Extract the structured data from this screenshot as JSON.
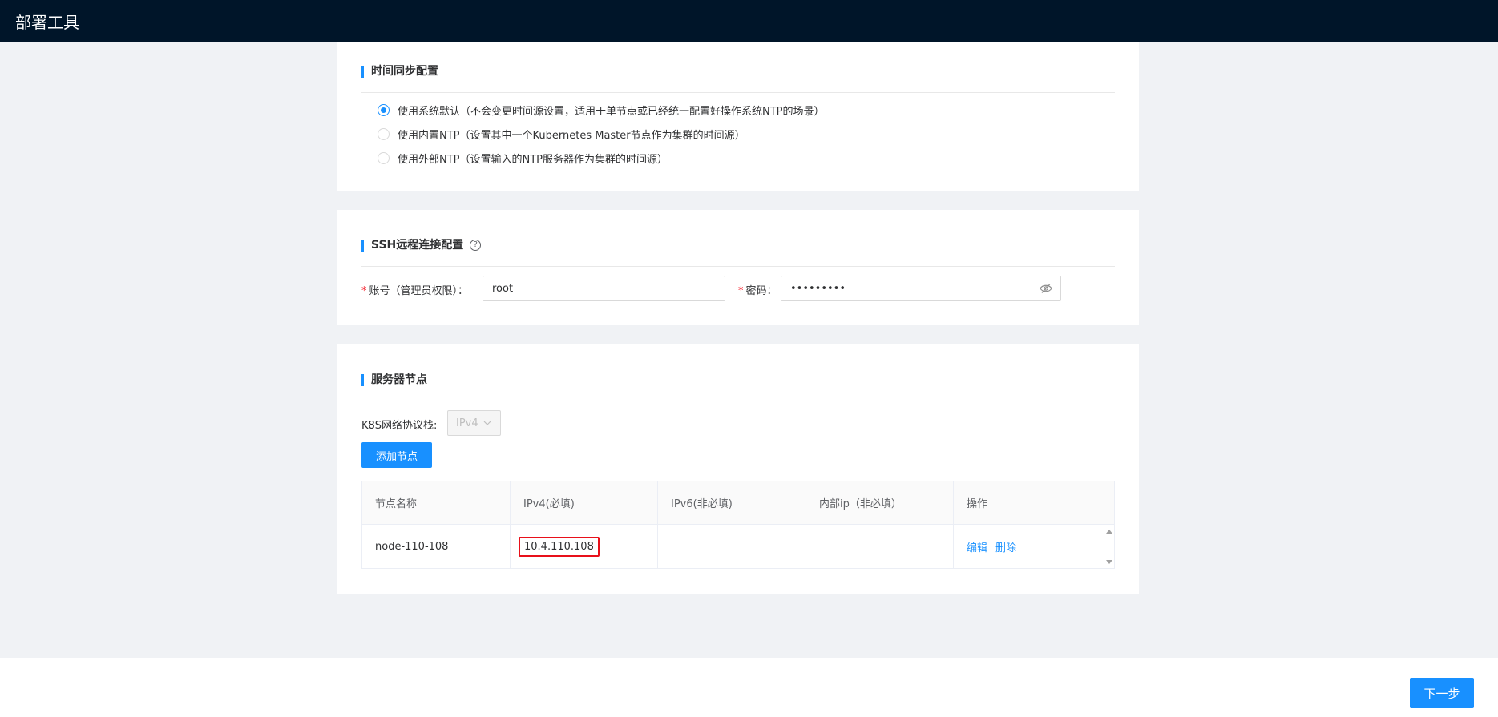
{
  "app": {
    "title": "部署工具"
  },
  "time_sync": {
    "title": "时间同步配置",
    "options": [
      {
        "label": "使用系统默认（不会变更时间源设置，适用于单节点或已经统一配置好操作系统NTP的场景）",
        "checked": true
      },
      {
        "label": "使用内置NTP（设置其中一个Kubernetes Master节点作为集群的时间源）",
        "checked": false
      },
      {
        "label": "使用外部NTP（设置输入的NTP服务器作为集群的时间源）",
        "checked": false
      }
    ]
  },
  "ssh": {
    "title": "SSH远程连接配置",
    "help_icon": "?",
    "account_required": "*",
    "account_label": "账号（管理员权限）：",
    "account_value": "root",
    "password_required": "*",
    "password_label": "密码：",
    "password_value": "•••••••••",
    "eye_icon": "eye-off-icon"
  },
  "nodes": {
    "title": "服务器节点",
    "protocol_label": "K8S网络协议栈:",
    "protocol_value": "IPv4",
    "add_button": "添加节点",
    "columns": [
      "节点名称",
      "IPv4(必填)",
      "IPv6(非必填)",
      "内部ip（非必填）",
      "操作"
    ],
    "rows": [
      {
        "name": "node-110-108",
        "ipv4": "10.4.110.108",
        "ipv6": "",
        "internal_ip": "",
        "edit": "编辑",
        "delete": "删除"
      }
    ]
  },
  "footer": {
    "next_button": "下一步"
  },
  "colors": {
    "accent": "#1890ff",
    "topbar": "#001529",
    "highlight": "#e8101a"
  }
}
